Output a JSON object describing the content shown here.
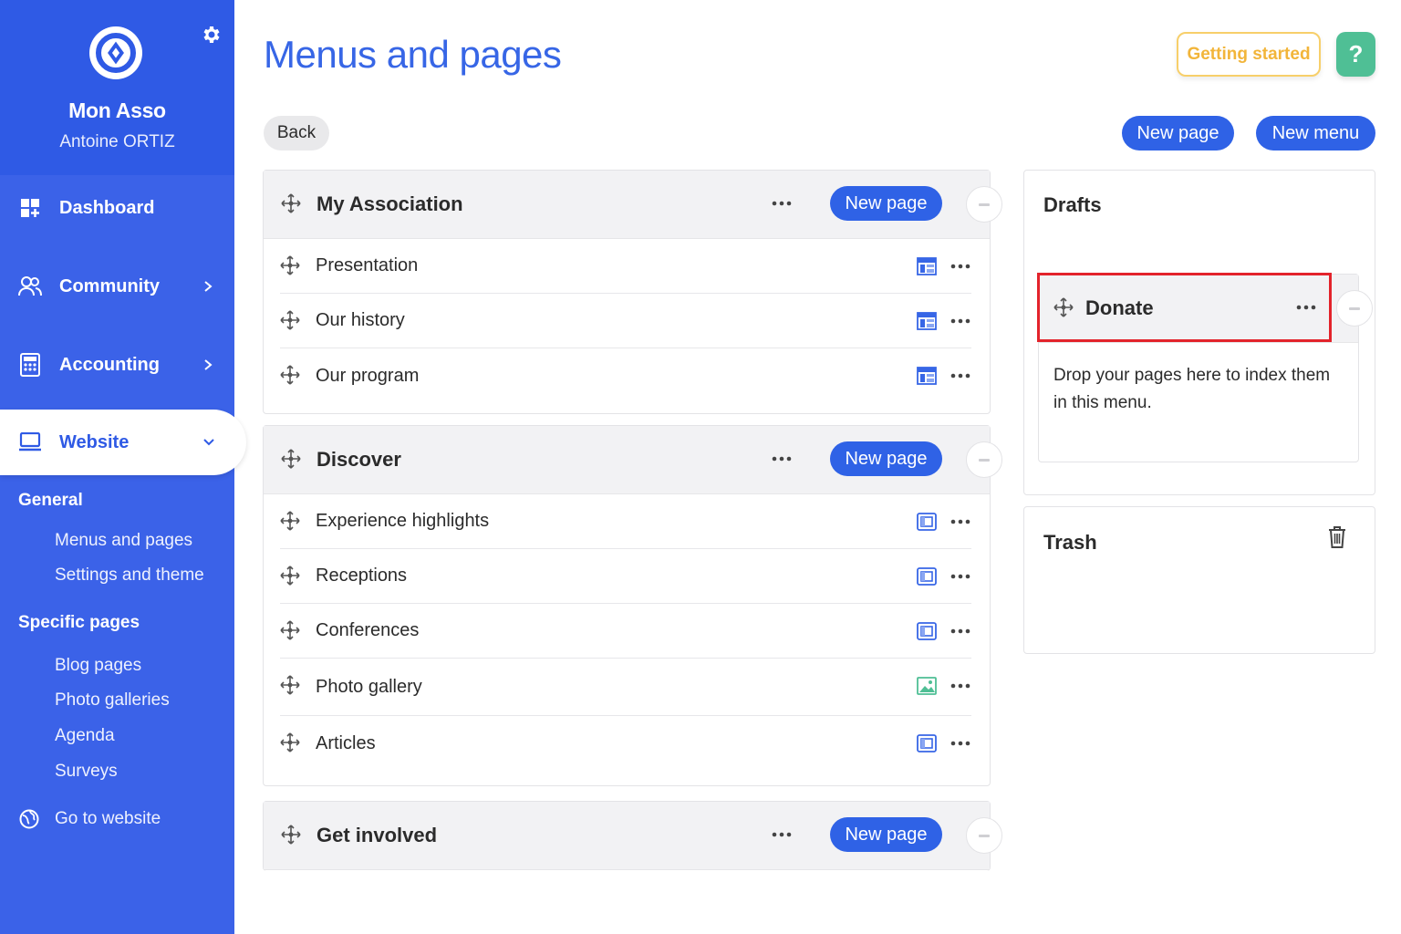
{
  "sidebar": {
    "org_name": "Mon Asso",
    "user_name": "Antoine ORTIZ",
    "nav": {
      "dashboard": "Dashboard",
      "community": "Community",
      "accounting": "Accounting",
      "website": "Website"
    },
    "sections": {
      "general": "General",
      "general_items": [
        "Menus and pages",
        "Settings and theme"
      ],
      "specific": "Specific pages",
      "specific_items": [
        "Blog pages",
        "Photo galleries",
        "Agenda",
        "Surveys"
      ]
    },
    "go_to_website": "Go to website"
  },
  "header": {
    "title": "Menus and pages",
    "getting_started": "Getting started",
    "help": "?"
  },
  "toolbar": {
    "back": "Back",
    "new_page": "New page",
    "new_menu": "New menu"
  },
  "menus": [
    {
      "title": "My Association",
      "new_page": "New page",
      "pages": [
        {
          "name": "Presentation",
          "type": "layout-page-icon"
        },
        {
          "name": "Our history",
          "type": "layout-page-icon"
        },
        {
          "name": "Our program",
          "type": "layout-page-icon"
        }
      ]
    },
    {
      "title": "Discover",
      "new_page": "New page",
      "pages": [
        {
          "name": "Experience highlights",
          "type": "window-page-icon"
        },
        {
          "name": "Receptions",
          "type": "window-page-icon"
        },
        {
          "name": "Conferences",
          "type": "window-page-icon"
        },
        {
          "name": "Photo gallery",
          "type": "image-page-icon"
        },
        {
          "name": "Articles",
          "type": "window-page-icon"
        }
      ]
    },
    {
      "title": "Get involved",
      "new_page": "New page",
      "pages": []
    }
  ],
  "drafts": {
    "title": "Drafts",
    "item": "Donate",
    "drop_text": "Drop your pages here to index them in this menu."
  },
  "trash": {
    "title": "Trash"
  },
  "colors": {
    "brand_blue": "#2f5ae5",
    "accent_blue": "#2f62e6",
    "help_green": "#4fbf95",
    "started_yellow": "#f2b53a",
    "highlight_red": "#e3232b"
  }
}
